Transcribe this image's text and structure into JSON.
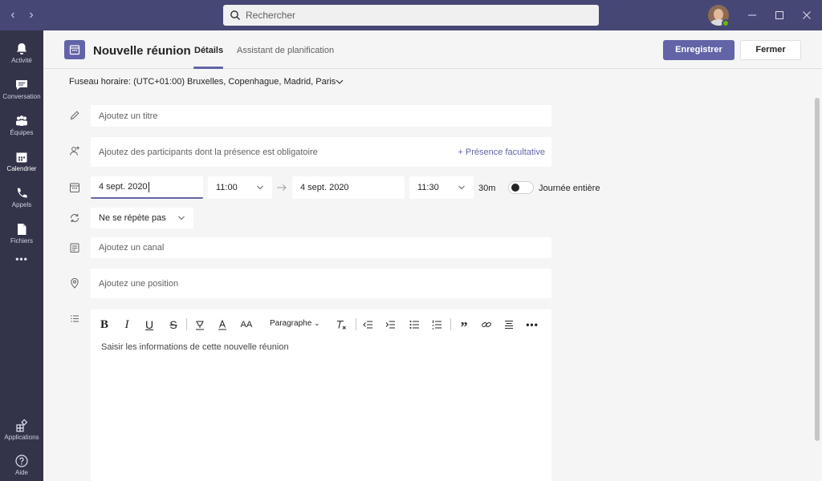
{
  "titlebar": {
    "search_placeholder": "Rechercher",
    "back_icon": "chevron-left-icon",
    "forward_icon": "chevron-right-icon"
  },
  "rail": {
    "items": [
      {
        "label": "Activité",
        "icon": "bell-icon"
      },
      {
        "label": "Conversation",
        "icon": "chat-icon"
      },
      {
        "label": "Équipes",
        "icon": "teams-icon"
      },
      {
        "label": "Calendrier",
        "icon": "calendar-icon"
      },
      {
        "label": "Appels",
        "icon": "phone-icon"
      },
      {
        "label": "Fichiers",
        "icon": "file-icon"
      }
    ],
    "more": "•••",
    "bottom": [
      {
        "label": "Applications",
        "icon": "apps-icon"
      },
      {
        "label": "Aide",
        "icon": "help-icon"
      }
    ]
  },
  "header": {
    "title": "Nouvelle réunion",
    "tabs": [
      "Détails",
      "Assistant de planification"
    ],
    "save_label": "Enregistrer",
    "close_label": "Fermer"
  },
  "timezone": "Fuseau horaire: (UTC+01:00) Bruxelles, Copenhague, Madrid, Paris",
  "form": {
    "title_placeholder": "Ajoutez un titre",
    "participants_placeholder": "Ajoutez des participants dont la présence est obligatoire",
    "optional_link": "+ Présence facultative",
    "start_date": "4 sept. 2020",
    "start_time": "11:00",
    "end_date": "4 sept. 2020",
    "end_time": "11:30",
    "duration": "30m",
    "all_day_label": "Journée entière",
    "all_day_on": false,
    "repeat": "Ne se répète pas",
    "channel_placeholder": "Ajoutez un canal",
    "location_placeholder": "Ajoutez une position"
  },
  "editor": {
    "paragraph_label": "Paragraphe",
    "placeholder": "Saisir les informations de cette nouvelle réunion",
    "more": "•••"
  },
  "colors": {
    "accent": "#6264a7",
    "titlebar": "#464775",
    "rail": "#33344a"
  }
}
